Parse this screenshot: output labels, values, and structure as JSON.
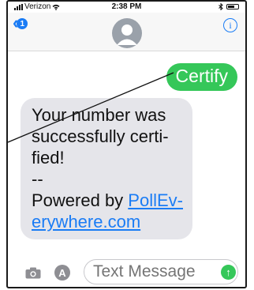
{
  "status_bar": {
    "carrier": "Verizon",
    "time": "2:38 PM"
  },
  "nav": {
    "back_badge": "1",
    "info_label": "i"
  },
  "messages": [
    {
      "direction": "outgoing",
      "text": "Certify"
    },
    {
      "direction": "incoming",
      "lines": [
        "Your number was",
        "successfully certi-",
        "fied!",
        "--",
        "Powered by "
      ],
      "link_lines": [
        "PollEv-",
        "erywhere.com"
      ]
    }
  ],
  "composer": {
    "placeholder": "Text Message",
    "app_icon_glyph": "A",
    "send_glyph": "↑"
  },
  "colors": {
    "imessage_green": "#35c759",
    "ios_blue": "#1a7cf5",
    "incoming_bubble": "#e5e5ea"
  }
}
